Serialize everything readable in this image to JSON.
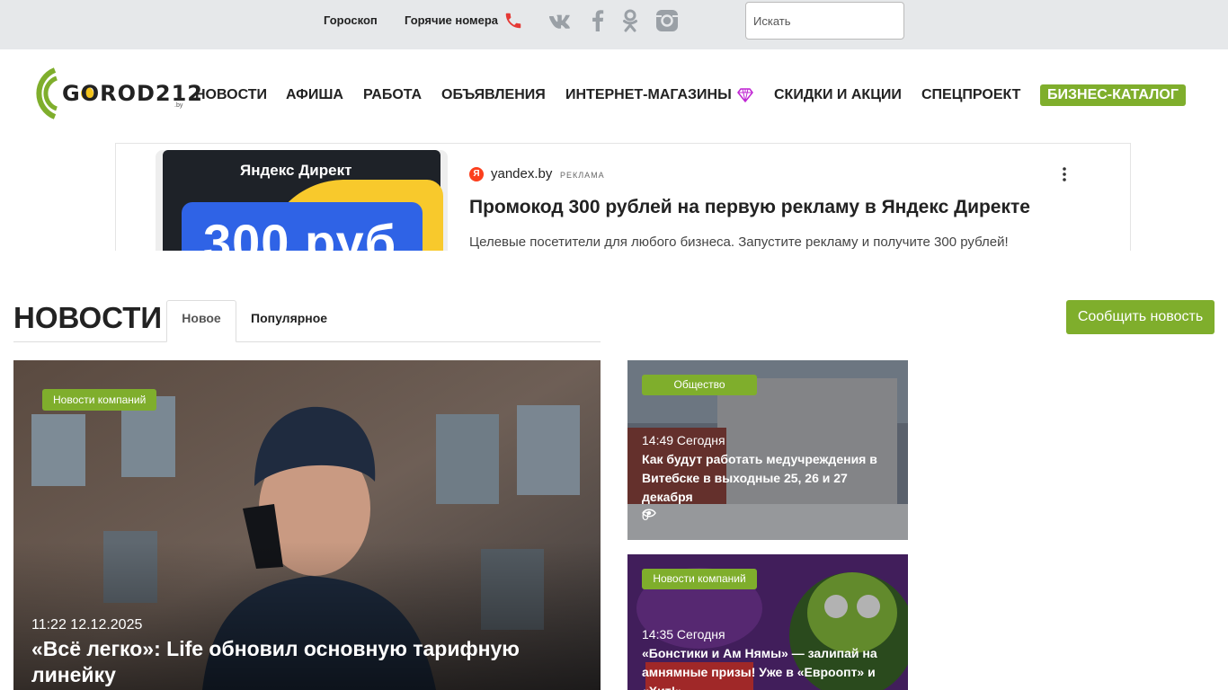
{
  "topbar": {
    "horoscope": "Гороскоп",
    "hot_numbers": "Горячие номера",
    "search_placeholder": "Искать",
    "social": [
      "vk-icon",
      "facebook-icon",
      "odnoklassniki-icon",
      "instagram-icon"
    ]
  },
  "logo": {
    "text": "GOROD212",
    "suffix": ".by"
  },
  "nav": {
    "news": "НОВОСТИ",
    "afisha": "АФИША",
    "rabota": "РАБОТА",
    "obyavleniya": "ОБЪЯВЛЕНИЯ",
    "internet_shops": "ИНТЕРНЕТ-МАГАЗИНЫ",
    "skidki": "СКИДКИ И АКЦИИ",
    "specproekt": "СПЕЦПРОЕКТ",
    "business_catalog": "БИЗНЕС-КАТАЛОГ"
  },
  "ad": {
    "image_brand": "Яндекс Директ",
    "image_price": "300 руб.",
    "domain": "yandex.by",
    "label": "РЕКЛАМА",
    "title": "Промокод 300 рублей на первую рекламу в Яндекс Директе",
    "description": "Целевые посетители для любого бизнеса. Запустите рекламу и получите 300 рублей!"
  },
  "news_section": {
    "heading": "НОВОСТИ",
    "tabs": [
      "Новое",
      "Популярное"
    ],
    "report_button": "Сообщить новость"
  },
  "main_article": {
    "tag": "Новости компаний",
    "time": "11:22 12.12.2025",
    "title": "«Всё легко»: Life обновил основную тарифную линейку"
  },
  "side_articles": [
    {
      "tag": "Общество",
      "time": "14:49 Сегодня",
      "title": "Как будут работать медучреждения в Витебске в выходные 25, 26 и 27 декабря",
      "views": "0"
    },
    {
      "tag": "Новости компаний",
      "time": "14:35 Сегодня",
      "title": "«Бонстики и Ам Нямы» — залипай на амнямные призы! Уже в «Евроопт» и «Хит!»"
    }
  ],
  "colors": {
    "accent": "#7fae2c",
    "topbar_bg": "#e6e8ea",
    "phone": "#e53935",
    "gem": "#c026d3"
  }
}
